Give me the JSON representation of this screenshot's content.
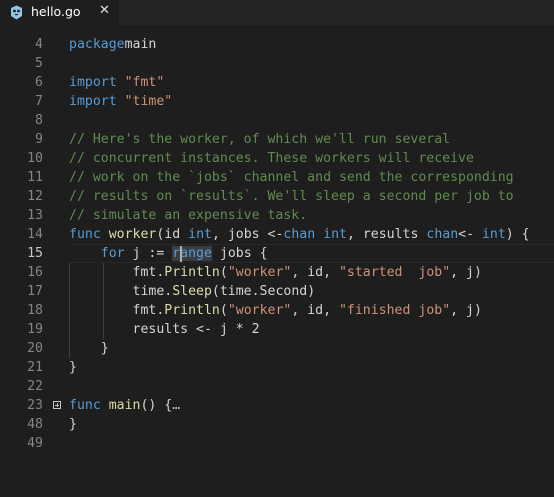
{
  "tab": {
    "filename": "hello.go",
    "close_glyph": "✕",
    "icon": "go-file-icon"
  },
  "colors": {
    "background": "#1e1e1e",
    "keyword": "#569cd6",
    "string": "#ce9178",
    "comment": "#608b4e",
    "function": "#dcdcaa",
    "text": "#d4d4d4",
    "line_number": "#858585"
  },
  "editor": {
    "active_line": "15",
    "lines": [
      {
        "n": "4",
        "tokens": [
          [
            "kw",
            "package"
          ],
          [
            "",
            "main"
          ]
        ]
      },
      {
        "n": "5",
        "tokens": []
      },
      {
        "n": "6",
        "tokens": [
          [
            "kw",
            "import"
          ],
          [
            "",
            " "
          ],
          [
            "str",
            "\"fmt\""
          ]
        ]
      },
      {
        "n": "7",
        "tokens": [
          [
            "kw",
            "import"
          ],
          [
            "",
            " "
          ],
          [
            "str",
            "\"time\""
          ]
        ]
      },
      {
        "n": "8",
        "tokens": []
      },
      {
        "n": "9",
        "tokens": [
          [
            "cmt",
            "// Here's the worker, of which we'll run several"
          ]
        ]
      },
      {
        "n": "10",
        "tokens": [
          [
            "cmt",
            "// concurrent instances. These workers will receive"
          ]
        ]
      },
      {
        "n": "11",
        "tokens": [
          [
            "cmt",
            "// work on the `jobs` channel and send the corresponding"
          ]
        ]
      },
      {
        "n": "12",
        "tokens": [
          [
            "cmt",
            "// results on `results`. We'll sleep a second per job to"
          ]
        ]
      },
      {
        "n": "13",
        "tokens": [
          [
            "cmt",
            "// simulate an expensive task."
          ]
        ]
      },
      {
        "n": "14",
        "tokens": [
          [
            "kw",
            "func"
          ],
          [
            "",
            " "
          ],
          [
            "fn",
            "worker"
          ],
          [
            "",
            "(id "
          ],
          [
            "kw",
            "int"
          ],
          [
            "",
            ", jobs <-"
          ],
          [
            "kw",
            "chan"
          ],
          [
            "",
            " "
          ],
          [
            "kw",
            "int"
          ],
          [
            "",
            ", results "
          ],
          [
            "kw",
            "chan"
          ],
          [
            "",
            "<- "
          ],
          [
            "kw",
            "int"
          ],
          [
            "",
            ") {"
          ]
        ]
      },
      {
        "n": "15",
        "tokens": [
          [
            "",
            "    "
          ],
          [
            "kw",
            "for"
          ],
          [
            "",
            " j := "
          ],
          [
            "kw sel",
            "range"
          ],
          [
            "",
            " jobs {"
          ]
        ]
      },
      {
        "n": "16",
        "tokens": [
          [
            "",
            "        fmt."
          ],
          [
            "fn",
            "Println"
          ],
          [
            "",
            "("
          ],
          [
            "str",
            "\"worker\""
          ],
          [
            "",
            ", id, "
          ],
          [
            "str",
            "\"started  job\""
          ],
          [
            "",
            ", j)"
          ]
        ]
      },
      {
        "n": "17",
        "tokens": [
          [
            "",
            "        time."
          ],
          [
            "fn",
            "Sleep"
          ],
          [
            "",
            "(time.Second)"
          ]
        ]
      },
      {
        "n": "18",
        "tokens": [
          [
            "",
            "        fmt."
          ],
          [
            "fn",
            "Println"
          ],
          [
            "",
            "("
          ],
          [
            "str",
            "\"worker\""
          ],
          [
            "",
            ", id, "
          ],
          [
            "str",
            "\"finished job\""
          ],
          [
            "",
            ", j)"
          ]
        ]
      },
      {
        "n": "19",
        "tokens": [
          [
            "",
            "        results <- j * 2"
          ]
        ]
      },
      {
        "n": "20",
        "tokens": [
          [
            "",
            "    }"
          ]
        ]
      },
      {
        "n": "21",
        "tokens": [
          [
            "",
            "}"
          ]
        ]
      },
      {
        "n": "22",
        "tokens": []
      },
      {
        "n": "23",
        "tokens": [
          [
            "kw",
            "func"
          ],
          [
            "",
            " "
          ],
          [
            "fn",
            "main"
          ],
          [
            "",
            "() {"
          ],
          [
            "ellipsis",
            "…"
          ]
        ],
        "folded": true
      },
      {
        "n": "48",
        "tokens": [
          [
            "",
            "}"
          ]
        ]
      },
      {
        "n": "49",
        "tokens": []
      }
    ]
  }
}
